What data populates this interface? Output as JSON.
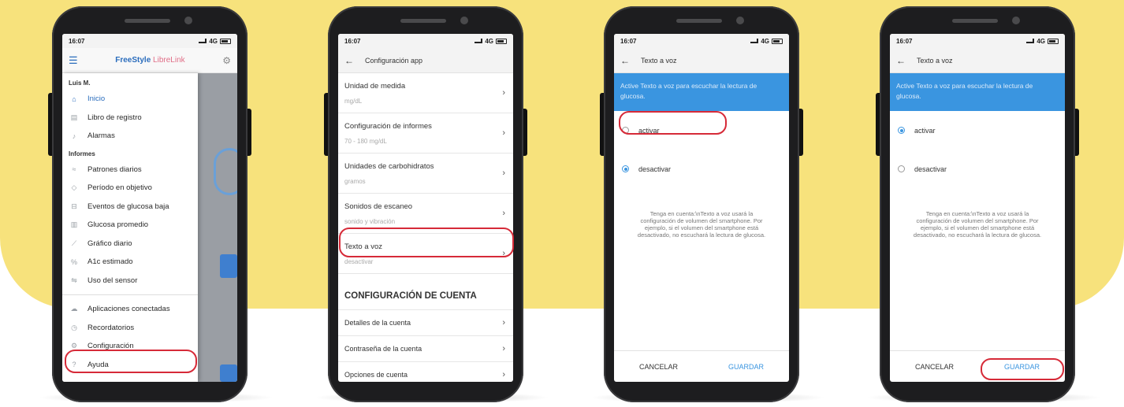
{
  "colors": {
    "background_panel": "#f7e27c",
    "highlight": "#d62a38",
    "accent_blue": "#3a95e0",
    "brand_blue": "#2b6dbd",
    "brand_pink": "#e06e87"
  },
  "status_bar": {
    "time": "16:07",
    "network": "4G"
  },
  "phone1": {
    "brand_part1": "FreeStyle",
    "brand_part2": "LibreLink",
    "user": "Luis M.",
    "items": [
      {
        "label": "Inicio",
        "icon": "home-icon",
        "glyph": "⌂"
      },
      {
        "label": "Libro de registro",
        "icon": "logbook-icon",
        "glyph": "▤"
      },
      {
        "label": "Alarmas",
        "icon": "bell-icon",
        "glyph": "♪"
      }
    ],
    "section": "Informes",
    "reports": [
      {
        "label": "Patrones diarios",
        "icon": "patterns-icon",
        "glyph": "≈"
      },
      {
        "label": "Período en objetivo",
        "icon": "target-icon",
        "glyph": "◇"
      },
      {
        "label": "Eventos de glucosa baja",
        "icon": "low-glucose-icon",
        "glyph": "⊟"
      },
      {
        "label": "Glucosa promedio",
        "icon": "bar-chart-icon",
        "glyph": "▥"
      },
      {
        "label": "Gráfico diario",
        "icon": "line-chart-icon",
        "glyph": "⟋"
      },
      {
        "label": "A1c estimado",
        "icon": "percent-icon",
        "glyph": "%"
      },
      {
        "label": "Uso del sensor",
        "icon": "sensor-icon",
        "glyph": "⇋"
      }
    ],
    "bottom": [
      {
        "label": "Aplicaciones conectadas",
        "icon": "cloud-icon",
        "glyph": "☁"
      },
      {
        "label": "Recordatorios",
        "icon": "clock-icon",
        "glyph": "◷"
      },
      {
        "label": "Configuración",
        "icon": "gear-icon",
        "glyph": "⚙"
      },
      {
        "label": "Ayuda",
        "icon": "help-icon",
        "glyph": "?"
      }
    ]
  },
  "phone2": {
    "title": "Configuración app",
    "settings": [
      {
        "title": "Unidad de medida",
        "value": "mg/dL"
      },
      {
        "title": "Configuración de informes",
        "value": "70 - 180 mg/dL"
      },
      {
        "title": "Unidades de carbohidratos",
        "value": "gramos"
      },
      {
        "title": "Sonidos de escaneo",
        "value": "sonido y vibración"
      },
      {
        "title": "Texto a voz",
        "value": "desactivar"
      }
    ],
    "account_section": "CONFIGURACIÓN DE CUENTA",
    "account": [
      "Detalles de la cuenta",
      "Contraseña de la cuenta",
      "Opciones de cuenta"
    ]
  },
  "tts": {
    "title": "Texto a voz",
    "banner": "Active Texto a voz para escuchar la lectura de glucosa.",
    "options": [
      "activar",
      "desactivar"
    ],
    "note": "Tenga en cuenta:\\nTexto a voz usará la configuración de volumen del smartphone. Por ejemplo, si el volumen del smartphone está desactivado, no escuchará la lectura de glucosa.",
    "cancel": "CANCELAR",
    "save": "GUARDAR"
  },
  "phone3_selected": "desactivar",
  "phone4_selected": "activar"
}
